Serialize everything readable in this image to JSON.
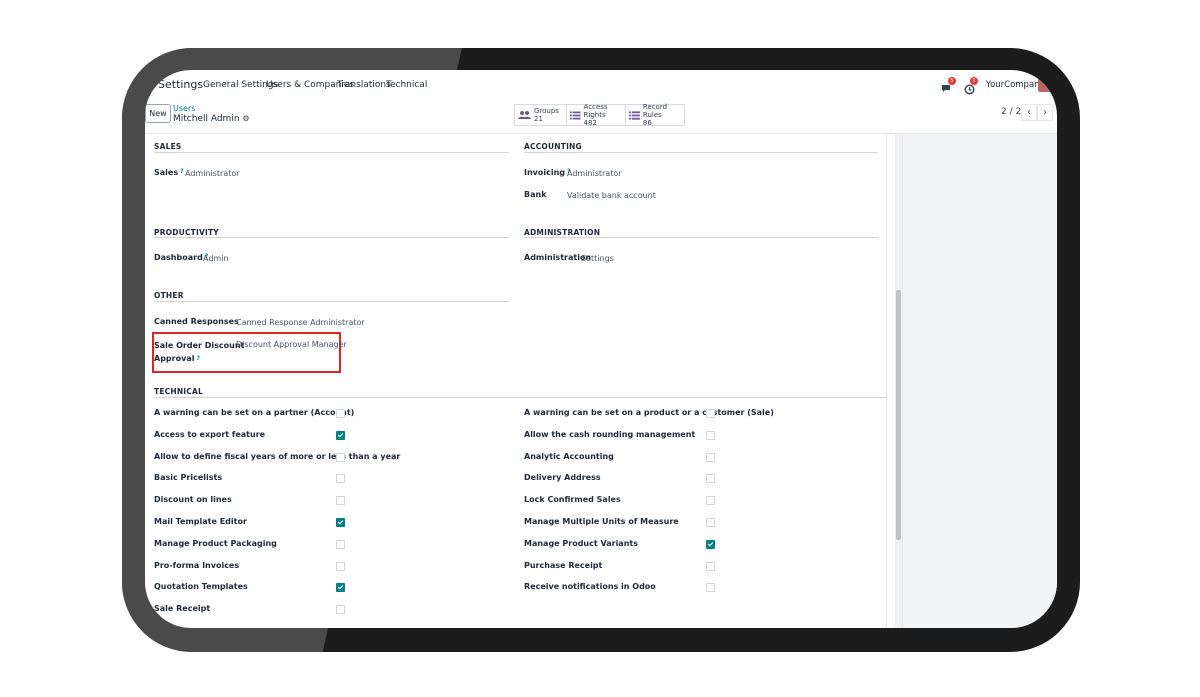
{
  "nav": {
    "brand": "Settings",
    "menu": [
      "General Settings",
      "Users & Companies",
      "Translations",
      "Technical"
    ],
    "company": "YourCompany",
    "messages_badge": "5",
    "activity_badge": "2"
  },
  "control": {
    "new_label": "New",
    "breadcrumb_parent": "Users",
    "record_name": "Mitchell Admin",
    "pager": "2 / 2",
    "stats": [
      {
        "label": "Groups",
        "count": "21"
      },
      {
        "label": "Access Rights",
        "count": "482"
      },
      {
        "label": "Record Rules",
        "count": "86"
      }
    ]
  },
  "form": {
    "sales": {
      "title": "SALES",
      "label": "Sales",
      "value": "Administrator"
    },
    "accounting": {
      "title": "ACCOUNTING",
      "invoicing_label": "Invoicing",
      "invoicing_value": "Administrator",
      "bank_label": "Bank",
      "bank_value": "Validate bank account"
    },
    "productivity": {
      "title": "PRODUCTIVITY",
      "label": "Dashboard",
      "value": "Admin"
    },
    "administration": {
      "title": "ADMINISTRATION",
      "label": "Administration",
      "value": "Settings"
    },
    "other": {
      "title": "OTHER",
      "canned_label": "Canned Responses",
      "canned_value": "Canned Response Administrator",
      "discount_label_1": "Sale Order Discount",
      "discount_label_2": "Approval",
      "discount_value": "Discount Approval Manager"
    },
    "technical_title": "TECHNICAL",
    "technical_left": [
      {
        "label": "A warning can be set on a partner (Account)",
        "checked": false
      },
      {
        "label": "Access to export feature",
        "checked": true
      },
      {
        "label": "Allow to define fiscal years of more or less than a year",
        "checked": false
      },
      {
        "label": "Basic Pricelists",
        "checked": false
      },
      {
        "label": "Discount on lines",
        "checked": false
      },
      {
        "label": "Mail Template Editor",
        "checked": true
      },
      {
        "label": "Manage Product Packaging",
        "checked": false
      },
      {
        "label": "Pro-forma Invoices",
        "checked": false
      },
      {
        "label": "Quotation Templates",
        "checked": true
      },
      {
        "label": "Sale Receipt",
        "checked": false
      }
    ],
    "technical_right": [
      {
        "label": "A warning can be set on a product or a customer (Sale)",
        "checked": false
      },
      {
        "label": "Allow the cash rounding management",
        "checked": false
      },
      {
        "label": "Analytic Accounting",
        "checked": false
      },
      {
        "label": "Delivery Address",
        "checked": false
      },
      {
        "label": "Lock Confirmed Sales",
        "checked": false
      },
      {
        "label": "Manage Multiple Units of Measure",
        "checked": false
      },
      {
        "label": "Manage Product Variants",
        "checked": true
      },
      {
        "label": "Purchase Receipt",
        "checked": false
      },
      {
        "label": "Receive notifications in Odoo",
        "checked": false
      }
    ]
  }
}
